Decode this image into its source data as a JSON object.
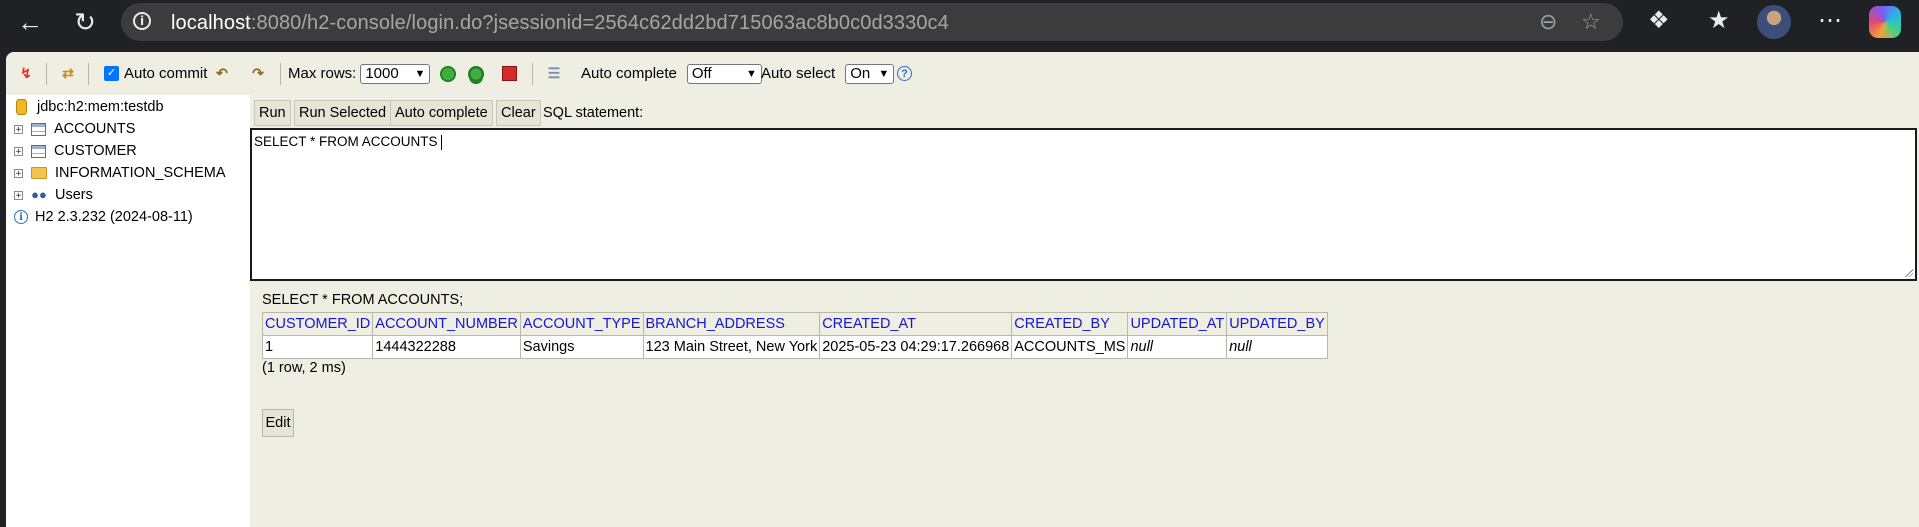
{
  "browser": {
    "url_host": "localhost",
    "url_rest": ":8080/h2-console/login.do?jsessionid=2564c62dd2bd715063ac8b0c0d3330c4",
    "icons": [
      "back-icon",
      "refresh-icon",
      "site-info-icon",
      "zoom-out-icon",
      "favorite-star-icon",
      "extensions-icon",
      "favorites-icon",
      "profile-avatar",
      "more-icon",
      "copilot-icon"
    ]
  },
  "toolbar": {
    "auto_commit_label": "Auto commit",
    "auto_commit_checked": true,
    "max_rows_label": "Max rows:",
    "max_rows_value": "1000",
    "auto_complete_label": "Auto complete",
    "auto_complete_value": "Off",
    "auto_select_label": "Auto select",
    "auto_select_value": "On",
    "help_glyph": "?"
  },
  "tree": {
    "connection": "jdbc:h2:mem:testdb",
    "items": [
      {
        "label": "ACCOUNTS",
        "icon": "table-icon"
      },
      {
        "label": "CUSTOMER",
        "icon": "table-icon"
      },
      {
        "label": "INFORMATION_SCHEMA",
        "icon": "folder-icon"
      },
      {
        "label": "Users",
        "icon": "users-icon"
      }
    ],
    "version": "H2 2.3.232 (2024-08-11)"
  },
  "query": {
    "buttons": {
      "run": "Run",
      "run_selected": "Run Selected",
      "auto_complete": "Auto complete",
      "clear": "Clear"
    },
    "sql_label": "SQL statement:",
    "sql_text": "SELECT * FROM ACCOUNTS"
  },
  "result": {
    "statement": "SELECT * FROM ACCOUNTS;",
    "columns": [
      "CUSTOMER_ID",
      "ACCOUNT_NUMBER",
      "ACCOUNT_TYPE",
      "BRANCH_ADDRESS",
      "CREATED_AT",
      "CREATED_BY",
      "UPDATED_AT",
      "UPDATED_BY"
    ],
    "rows": [
      [
        "1",
        "1444322288",
        "Savings",
        "123 Main Street, New York",
        "2025-05-23 04:29:17.266968",
        "ACCOUNTS_MS",
        "null",
        "null"
      ]
    ],
    "summary": "(1 row, 2 ms)",
    "edit_label": "Edit"
  }
}
